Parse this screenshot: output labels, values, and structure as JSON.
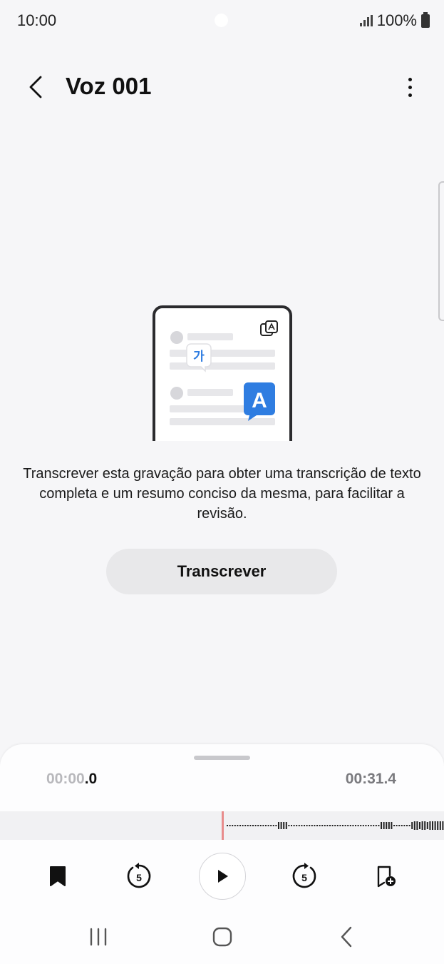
{
  "status_bar": {
    "time": "10:00",
    "battery": "100%",
    "icons": [
      "camera-dot",
      "signal-icon",
      "battery-icon"
    ]
  },
  "header": {
    "title": "Voz 001",
    "back_icon": "chevron-left-icon",
    "more_icon": "more-vertical-icon"
  },
  "illustration": {
    "korean_char": "가",
    "latin_char": "A",
    "translate_icon": "translate-icon",
    "colors": {
      "wave_teal": "#2fd6b0",
      "wave_blue": "#2f7de1",
      "bubble_blue": "#2f7de1"
    }
  },
  "main": {
    "description": "Transcrever esta gravação para obter uma transcrição de texto completa e um resumo conciso da mesma, para facilitar a revisão.",
    "transcribe_label": "Transcrever"
  },
  "player": {
    "current_time_main": "00:00",
    "current_time_ms": ".0",
    "total_time": "00:31.4",
    "playhead_color": "#e88c8c",
    "controls": [
      "bookmark-icon",
      "rewind-5-icon",
      "play-icon",
      "forward-5-icon",
      "add-bookmark-icon"
    ],
    "skip_seconds": "5"
  },
  "nav_bar": {
    "items": [
      "recents-icon",
      "home-icon",
      "back-icon"
    ]
  }
}
